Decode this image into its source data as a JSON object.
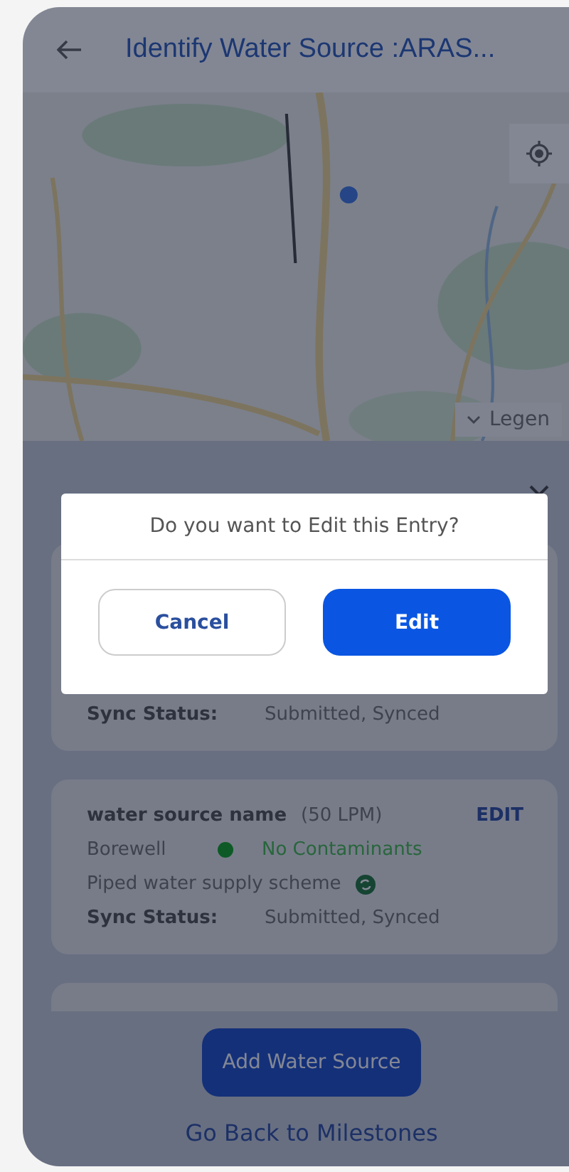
{
  "header": {
    "title": "Identify Water Source :ARAS..."
  },
  "map": {
    "kind": "picture",
    "legend_label": "Legen"
  },
  "sources": [
    {
      "kind": "partial",
      "sync_label": "Sync Status:",
      "sync_value": "Submitted, Synced"
    },
    {
      "kind": "full",
      "name": "water source name",
      "flow": "(50 LPM)",
      "edit_label": "EDIT",
      "type": "Borewell",
      "quality": "No Contaminants",
      "color": "#0d5a26",
      "scheme": "Piped water supply scheme",
      "sync_label": "Sync Status:",
      "sync_value": "Submitted, Synced"
    },
    {
      "kind": "stub"
    }
  ],
  "actions": {
    "add_label": "Add Water Source",
    "back_label": "Go Back to Milestones"
  },
  "dialog": {
    "message": "Do you want to Edit this Entry?",
    "cancel_label": "Cancel",
    "confirm_label": "Edit"
  }
}
